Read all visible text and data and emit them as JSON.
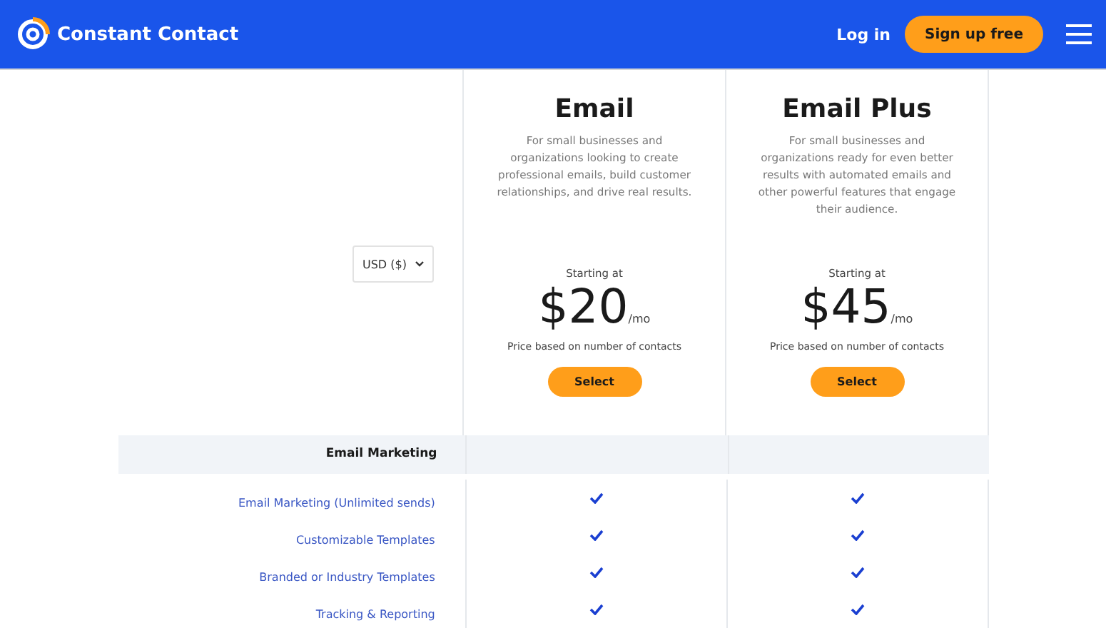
{
  "header": {
    "brand": "Constant Contact",
    "login": "Log in",
    "signup": "Sign up free"
  },
  "currency": {
    "value": "USD ($)"
  },
  "plans": [
    {
      "name": "Email",
      "description": "For small businesses and organizations looking to create professional emails, build customer relationships, and drive real results.",
      "starting": "Starting at",
      "price": "$20",
      "per": "/mo",
      "note": "Price based on number of contacts",
      "button": "Select"
    },
    {
      "name": "Email Plus",
      "description": "For small businesses and organizations ready for even better results with automated emails and other powerful features that engage their audience.",
      "starting": "Starting at",
      "price": "$45",
      "per": "/mo",
      "note": "Price based on number of contacts",
      "button": "Select"
    }
  ],
  "section": "Email Marketing",
  "features": [
    {
      "label": "Email Marketing (Unlimited sends)",
      "included": [
        true,
        true
      ]
    },
    {
      "label": "Customizable Templates",
      "included": [
        true,
        true
      ]
    },
    {
      "label": "Branded or Industry Templates",
      "included": [
        true,
        true
      ]
    },
    {
      "label": "Tracking & Reporting",
      "included": [
        true,
        true
      ]
    }
  ]
}
